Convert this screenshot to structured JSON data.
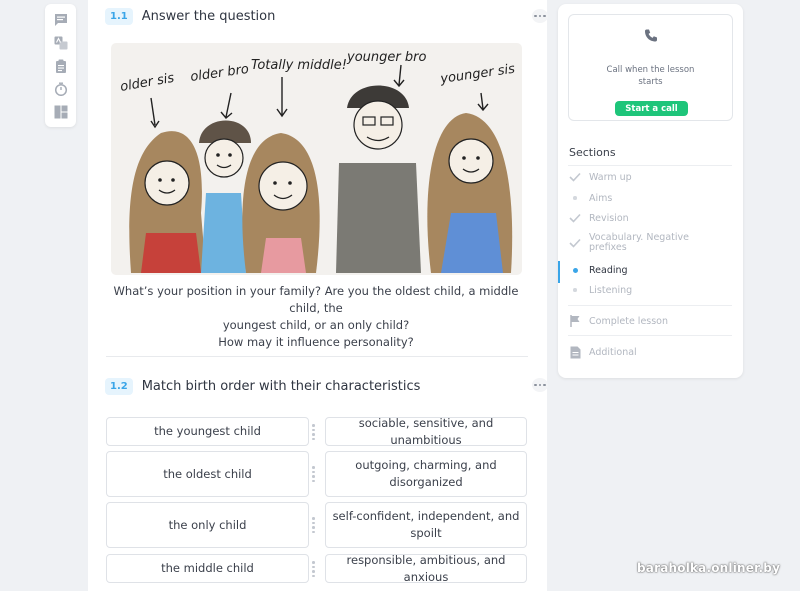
{
  "toolbar": {
    "tools": [
      {
        "icon": "chat-icon"
      },
      {
        "icon": "translate-icon"
      },
      {
        "icon": "clipboard-icon"
      },
      {
        "icon": "timer-icon"
      },
      {
        "icon": "layout-icon"
      }
    ]
  },
  "section1": {
    "number": "1.1",
    "title": "Answer the question",
    "picture_labels": [
      "older sis",
      "older bro",
      "Totally middle!",
      "younger bro",
      "younger sis"
    ],
    "question": [
      "What’s your position in your family? Are you the oldest child, a middle child, the",
      "youngest child, or an only child?",
      "How may it influence personality?"
    ]
  },
  "section2": {
    "number": "1.2",
    "title": "Match birth order with their characteristics",
    "left_items": [
      "the youngest child",
      "the oldest child",
      "the only child",
      "the middle child"
    ],
    "right_items": [
      "sociable, sensitive, and unambitious",
      "outgoing, charming, and disorganized",
      "self-confident, independent, and spoilt",
      "responsible, ambitious, and anxious"
    ]
  },
  "side": {
    "call_text": [
      "Call when the lesson",
      "starts"
    ],
    "call_button": "Start a call",
    "sections_title": "Sections",
    "sections": [
      {
        "label": "Warm up",
        "state": "done"
      },
      {
        "label": "Aims",
        "state": "pending"
      },
      {
        "label": "Revision",
        "state": "done"
      },
      {
        "label": "Vocabulary. Negative prefixes",
        "state": "done"
      },
      {
        "label": "Reading",
        "state": "active"
      },
      {
        "label": "Listening",
        "state": "pending"
      }
    ],
    "complete_lesson": "Complete lesson",
    "additional": "Additional"
  },
  "colors": {
    "accent": "#3aa5e8",
    "call_button": "#1ec57a",
    "muted": "#b2b7c0"
  },
  "watermark": "baraholka.onliner.by"
}
